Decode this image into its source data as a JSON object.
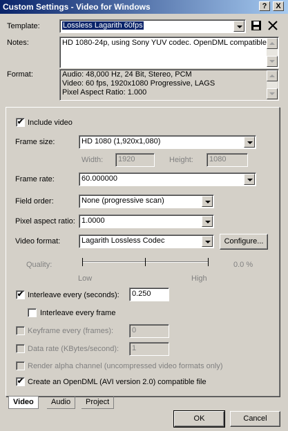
{
  "window": {
    "title": "Custom Settings - Video for Windows",
    "help_glyph": "?",
    "close_glyph": "X"
  },
  "template": {
    "label": "Template:",
    "value": "Lossless Lagarith 60fps"
  },
  "notes": {
    "label": "Notes:",
    "value": "HD 1080-24p, using Sony YUV codec. OpenDML compatible."
  },
  "format": {
    "label": "Format:",
    "lines": [
      "Audio: 48,000 Hz, 24 Bit, Stereo, PCM",
      "Video: 60 fps, 1920x1080 Progressive, LAGS",
      "Pixel Aspect Ratio: 1.000"
    ]
  },
  "video": {
    "include_video": {
      "label": "Include video",
      "checked": true
    },
    "frame_size": {
      "label": "Frame size:",
      "value": "HD 1080 (1,920x1,080)"
    },
    "width": {
      "label": "Width:",
      "value": "1920"
    },
    "height": {
      "label": "Height:",
      "value": "1080"
    },
    "frame_rate": {
      "label": "Frame rate:",
      "value": "60.000000"
    },
    "field_order": {
      "label": "Field order:",
      "value": "None (progressive scan)"
    },
    "pixel_aspect": {
      "label": "Pixel aspect ratio:",
      "value": "1.0000"
    },
    "video_format": {
      "label": "Video format:",
      "value": "Lagarith Lossless Codec"
    },
    "configure": "Configure...",
    "quality": {
      "label": "Quality:",
      "low": "Low",
      "high": "High",
      "readout": "0.0 %"
    },
    "interleave": {
      "label": "Interleave every (seconds):",
      "value": "0.250",
      "checked": true
    },
    "interleave_frame": {
      "label": "Interleave every frame",
      "checked": false
    },
    "keyframe": {
      "label": "Keyframe every (frames):",
      "value": "0"
    },
    "data_rate": {
      "label": "Data rate (KBytes/second):",
      "value": "1"
    },
    "render_alpha": {
      "label": "Render alpha channel (uncompressed video formats only)"
    },
    "opendml": {
      "label": "Create an OpenDML (AVI version 2.0) compatible file",
      "checked": true
    }
  },
  "tabs": [
    "Video",
    "Audio",
    "Project"
  ],
  "buttons": {
    "ok": "OK",
    "cancel": "Cancel"
  },
  "check_glyph": "✔"
}
